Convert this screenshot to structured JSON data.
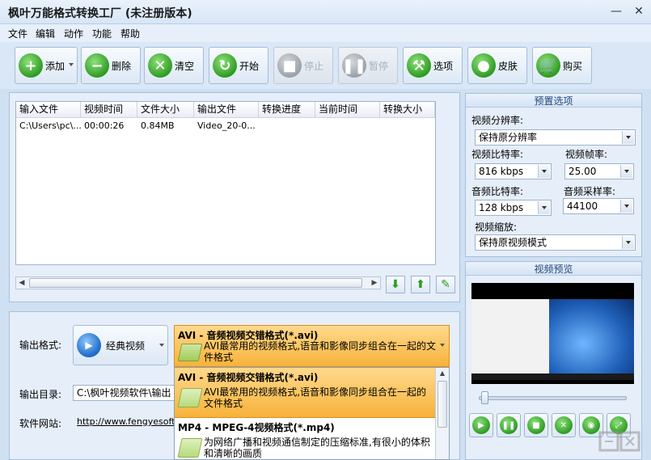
{
  "window": {
    "title": "枫叶万能格式转换工厂 (未注册版本)",
    "minimize_label": "—",
    "close_label": "✕"
  },
  "menu": [
    "文件",
    "编辑",
    "动作",
    "功能",
    "帮助"
  ],
  "toolbar": {
    "add": "添加",
    "delete": "删除",
    "clear": "清空",
    "start": "开始",
    "stop": "停止",
    "pause": "暂停",
    "options": "选项",
    "skin": "皮肤",
    "buy": "购买"
  },
  "file_table": {
    "columns": [
      "输入文件",
      "视频时间",
      "文件大小",
      "输出文件",
      "转换进度",
      "当前时间",
      "转换大小"
    ],
    "rows": [
      [
        "C:\\Users\\pc\\...",
        "00:00:26",
        "0.84MB",
        "Video_20-0...",
        "",
        "",
        ""
      ]
    ]
  },
  "output": {
    "format_label": "输出格式:",
    "format_category": "经典视频",
    "selected_format": {
      "title": "AVI - 音频视频交错格式(*.avi)",
      "desc": "AVI最常用的视频格式,语音和影像同步组合在一起的文件格式"
    },
    "dir_label": "输出目录:",
    "dir_value": "C:\\枫叶视频软件\\输出",
    "site_label": "软件网站:",
    "site_value": "http://www.fengyesoft.c"
  },
  "format_list": [
    {
      "title": "AVI - 音频视频交错格式(*.avi)",
      "desc": "AVI最常用的视频格式,语音和影像同步组合在一起的文件格式"
    },
    {
      "title": "MP4 - MPEG-4视频格式(*.mp4)",
      "desc": "为网络广播和视频通信制定的压缩标准,有很小的体积和清晰的画质"
    }
  ],
  "preset": {
    "title": "预置选项",
    "resolution_label": "视频分辨率:",
    "resolution_value": "保持原分辨率",
    "video_bitrate_label": "视频比特率:",
    "video_bitrate_value": "816 kbps",
    "framerate_label": "视频帧率:",
    "framerate_value": "25.00",
    "audio_bitrate_label": "音频比特率:",
    "audio_bitrate_value": "128 kbps",
    "samplerate_label": "音频采样率:",
    "samplerate_value": "44100",
    "scale_label": "视频缩放:",
    "scale_value": "保持原视频模式"
  },
  "preview": {
    "title": "视频预览",
    "slider_position": 0.02
  },
  "colors": {
    "accent_green": "#2f9c23",
    "selected_orange": "#f7b23b",
    "panel_bg": "#e5eef9"
  }
}
